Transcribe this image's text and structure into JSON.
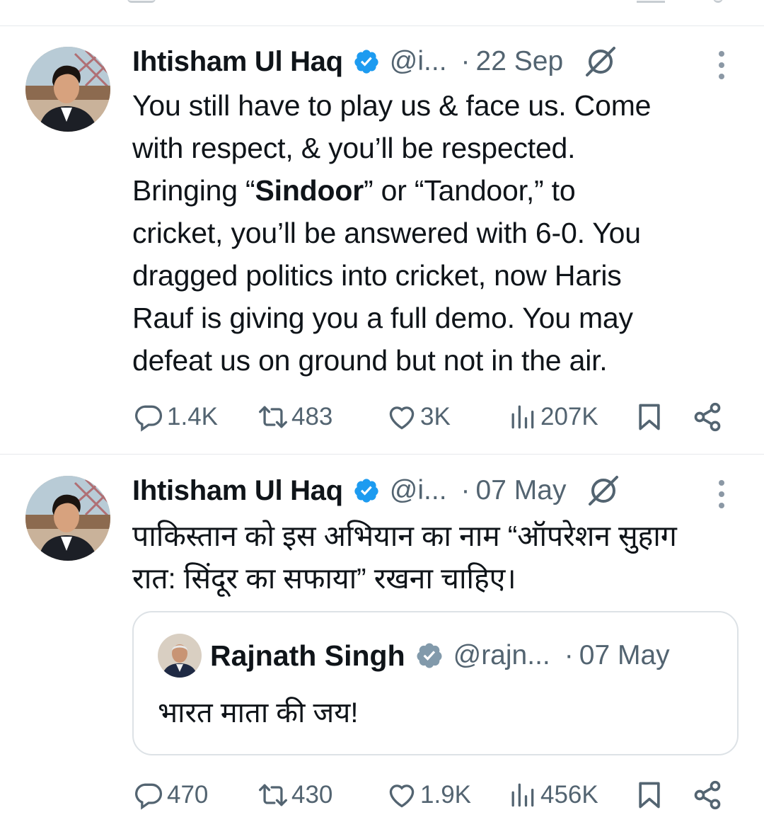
{
  "colors": {
    "verified_blue": "#1d9bf0",
    "verified_gray": "#829aab",
    "secondary_text": "#536471",
    "primary_text": "#0f1419",
    "divider": "#e6e9ec"
  },
  "tweets": [
    {
      "author_name": "Ihtisham Ul Haq",
      "handle": "@i...",
      "dot": "·",
      "date": "22 Sep",
      "verified": "blue-check-icon",
      "body": {
        "line1": "You still have to play us & face us. Come",
        "line2": "with respect, & you’ll be respected.",
        "line3_pre": "Bringing “",
        "line3_bold": "Sindoor",
        "line3_post": "” or “Tandoor,” to",
        "line4": "cricket, you’ll be answered with 6-0. You",
        "line5": "dragged politics into cricket, now Haris",
        "line6": "Rauf is giving you a full demo. You may",
        "line7": "defeat us on ground but not in the air."
      },
      "stats": {
        "replies": "1.4K",
        "reposts": "483",
        "likes": "3K",
        "views": "207K"
      }
    },
    {
      "author_name": "Ihtisham Ul Haq",
      "handle": "@i...",
      "dot": "·",
      "date": "07 May",
      "verified": "blue-check-icon",
      "body": {
        "line1": "पाकिस्तान को इस अभियान का नाम “ऑपरेशन सुहाग",
        "line2": "रात: सिंदूर का सफाया” रखना चाहिए।"
      },
      "quoted": {
        "author_name": "Rajnath Singh",
        "handle": "@rajn...",
        "dot": "·",
        "date": "07 May",
        "verified": "gray-check-icon",
        "text": "भारत माता की जय!"
      },
      "stats": {
        "replies": "470",
        "reposts": "430",
        "likes": "1.9K",
        "views": "456K"
      }
    }
  ]
}
